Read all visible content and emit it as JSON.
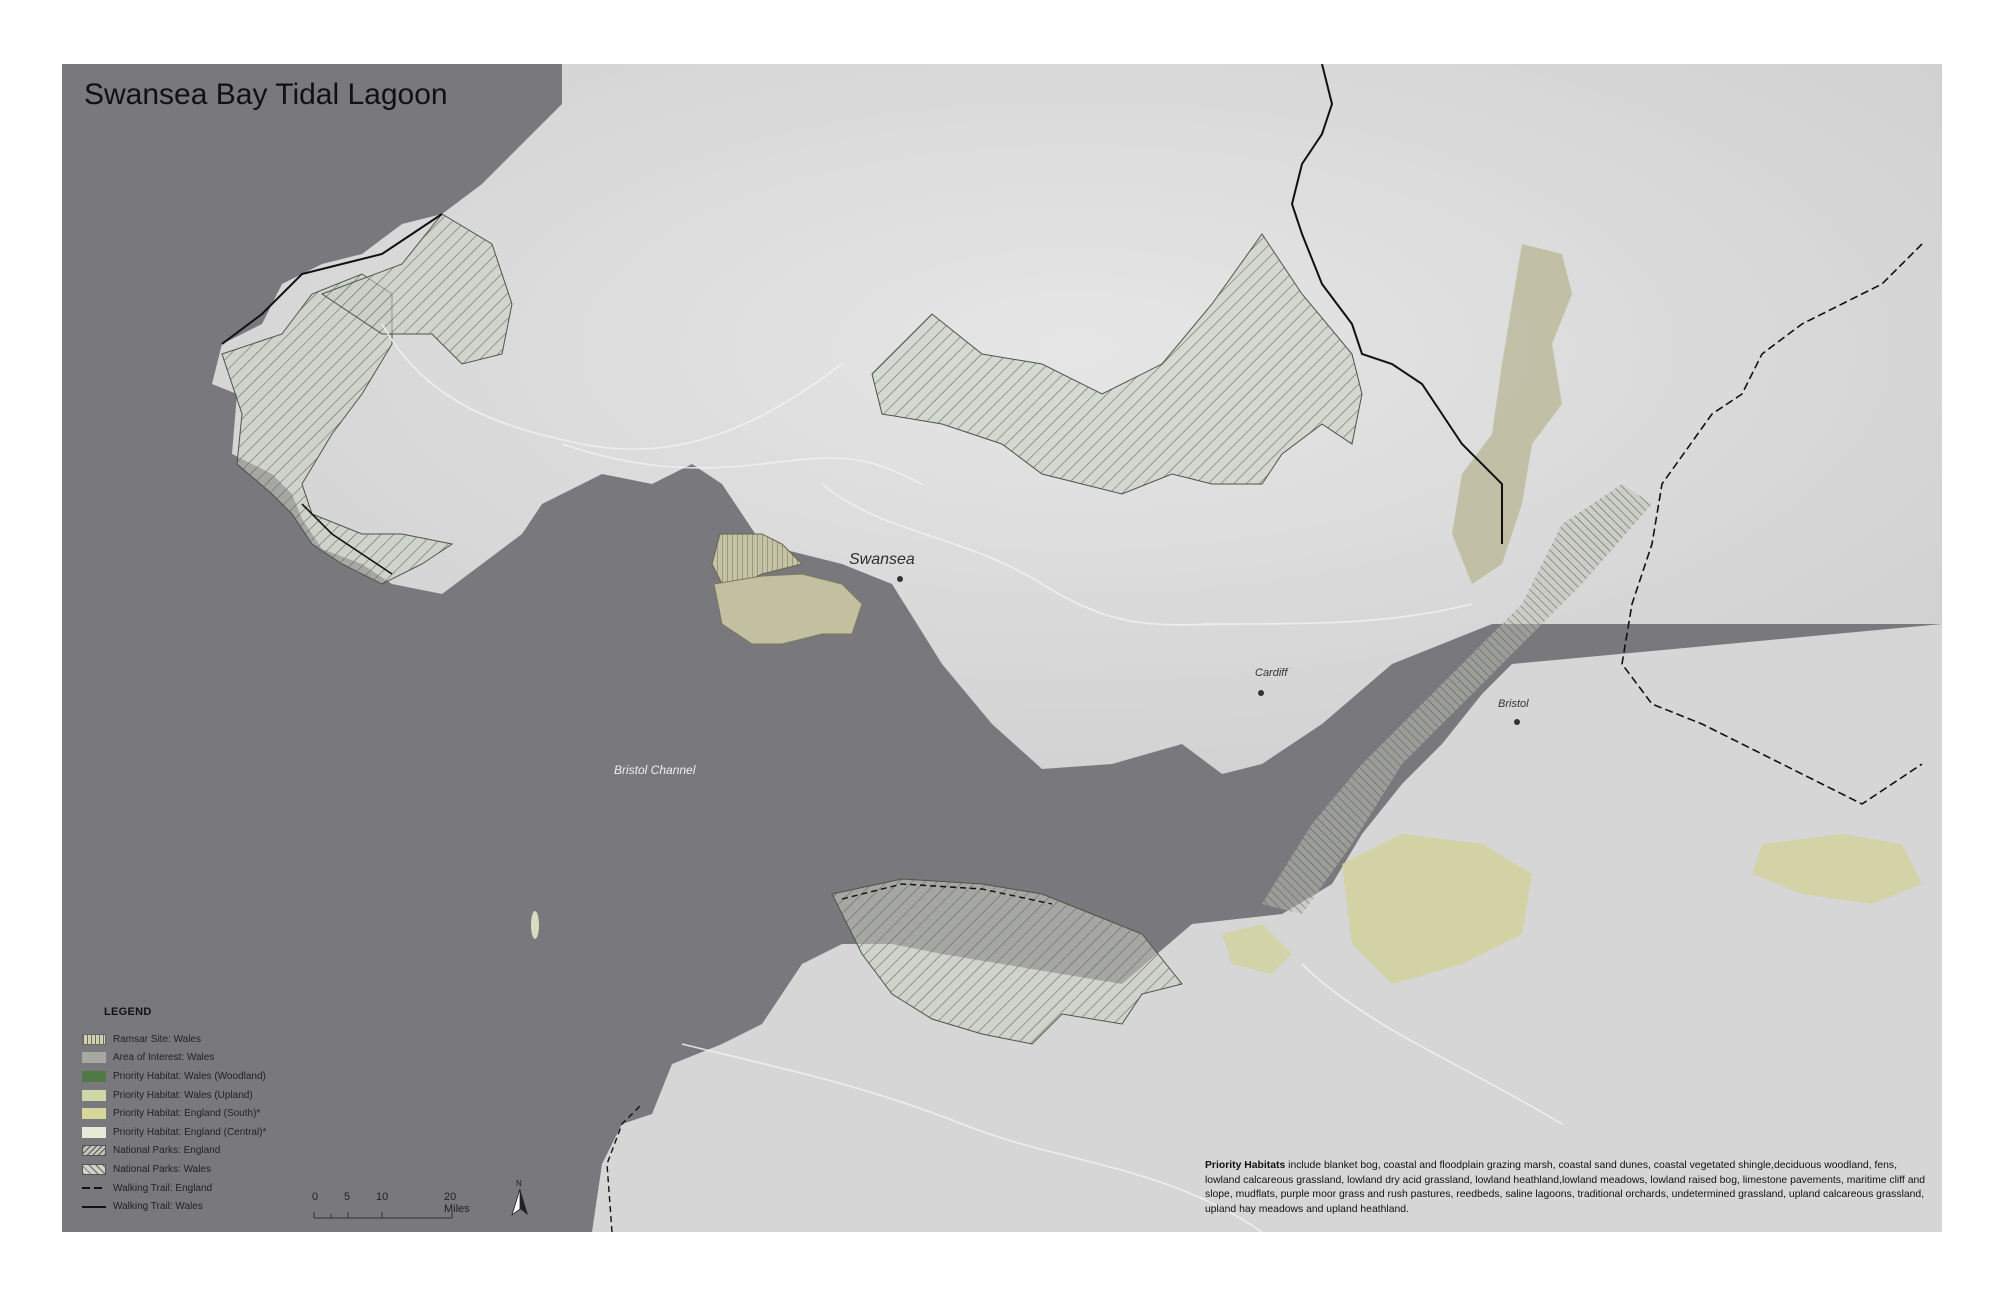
{
  "map": {
    "title": "Swansea Bay Tidal Lagoon",
    "places": {
      "swansea": "Swansea",
      "cardiff": "Cardiff",
      "bristol": "Bristol",
      "channel": "Bristol Channel"
    },
    "colors": {
      "sea": "#79787c",
      "land": "#dcdcdc",
      "ramsar": "#b9b8a2",
      "woodland": "#4f7a45",
      "upland": "#cdd7a8",
      "england_south": "#d6d69a",
      "england_central": "#e8e9d6",
      "boundary": "#111111"
    }
  },
  "legend": {
    "title": "LEGEND",
    "items": [
      {
        "label": "Ramsar Site: Wales",
        "swatch": "vertical-hatch"
      },
      {
        "label": "Area of Interest: Wales",
        "swatch": "grey-fill"
      },
      {
        "label": "Priority Habitat: Wales (Woodland)",
        "swatch": "dark-green-fill"
      },
      {
        "label": "Priority Habitat: Wales (Upland)",
        "swatch": "light-green-fill"
      },
      {
        "label": "Priority Habitat: England (South)*",
        "swatch": "olive-fill"
      },
      {
        "label": "Priority Habitat: England (Central)*",
        "swatch": "pale-fill"
      },
      {
        "label": "National Parks: England",
        "swatch": "dense-diagonal-hatch"
      },
      {
        "label": "National Parks: Wales",
        "swatch": "diagonal-hatch"
      },
      {
        "label": "Walking Trail: England",
        "swatch": "dashed-line"
      },
      {
        "label": "Walking Trail: Wales",
        "swatch": "solid-line"
      }
    ]
  },
  "scale_bar": {
    "labels": [
      "0",
      "5",
      "10",
      "20 Miles"
    ],
    "north_label": "N"
  },
  "note": {
    "bold": "Priority Habitats",
    "text": " include blanket bog, coastal and floodplain grazing marsh, coastal sand dunes, coastal vegetated shingle,deciduous woodland, fens, lowland calcareous grassland, lowland dry acid grassland, lowland heathland,lowland meadows, lowland raised bog, limestone pavements, maritime cliff and slope, mudflats, purple moor grass and rush pastures, reedbeds, saline lagoons, traditional orchards, undetermined grassland, upland calcareous grassland, upland hay meadows and upland heathland."
  }
}
